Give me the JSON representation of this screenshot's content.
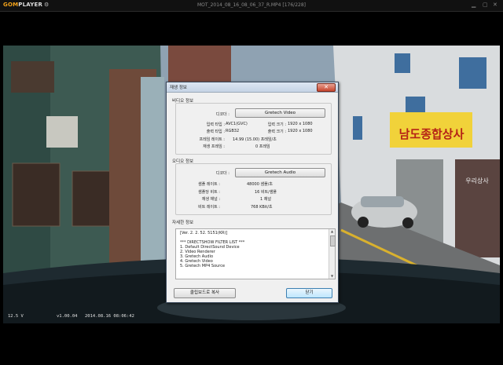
{
  "player": {
    "logo_brand": "GOM",
    "logo_suffix": "PLAYER",
    "file_title": "MOT_2014_08_16_08_06_37_R.MP4  [176/228]",
    "osd_voltage": "12.5 V",
    "osd_version": "v1.00.04",
    "osd_timestamp": "2014.08.16 08:06:42"
  },
  "scene": {
    "sign_text": "남도종합상사",
    "sign_small": "우리상사"
  },
  "dialog": {
    "title": "재생 정보",
    "close_label": "✕",
    "video": {
      "section_label": "비디오 정보",
      "decoder_label": "디코더 :",
      "decoder_value": "Gretech Video",
      "input_type_label": "입력 타입 :",
      "input_type_value": "AVC1(GVC)",
      "input_size_label": "입력 크기 :",
      "input_size_value": "1920 x 1080",
      "output_type_label": "출력 타입 :",
      "output_type_value": "RGB32",
      "output_size_label": "출력 크기 :",
      "output_size_value": "1920 x 1080",
      "framerate_label": "프레임 레이트 :",
      "framerate_value": "14.99 (15.00) 프레임/초",
      "playframe_label": "재생 프레임 :",
      "playframe_value": "0 프레임"
    },
    "audio": {
      "section_label": "오디오 정보",
      "decoder_label": "디코더 :",
      "decoder_value": "Gretech Audio",
      "sample_rate_label": "샘플 레이트 :",
      "sample_rate_value": "48000 샘플/초",
      "bits_label": "샘플당 비트 :",
      "bits_value": "16 비트/샘플",
      "channels_label": "재생 채널 :",
      "channels_value": "1 채널",
      "bitrate_label": "비트 레이트 :",
      "bitrate_value": "768 KBit/초"
    },
    "detail": {
      "section_label": "자세한 정보",
      "lines": [
        "[Ver. 2. 2. 52. 5151(KR)]",
        "",
        "*** DIRECTSHOW FILTER LIST ***",
        "1. Default DirectSound Device",
        "2. Video Renderer",
        "3. Gretech Audio",
        "4. Gretech Video",
        "5. Gretech MP4 Source"
      ]
    },
    "copy_button": "클립보드로 복사",
    "close_button": "닫기"
  }
}
